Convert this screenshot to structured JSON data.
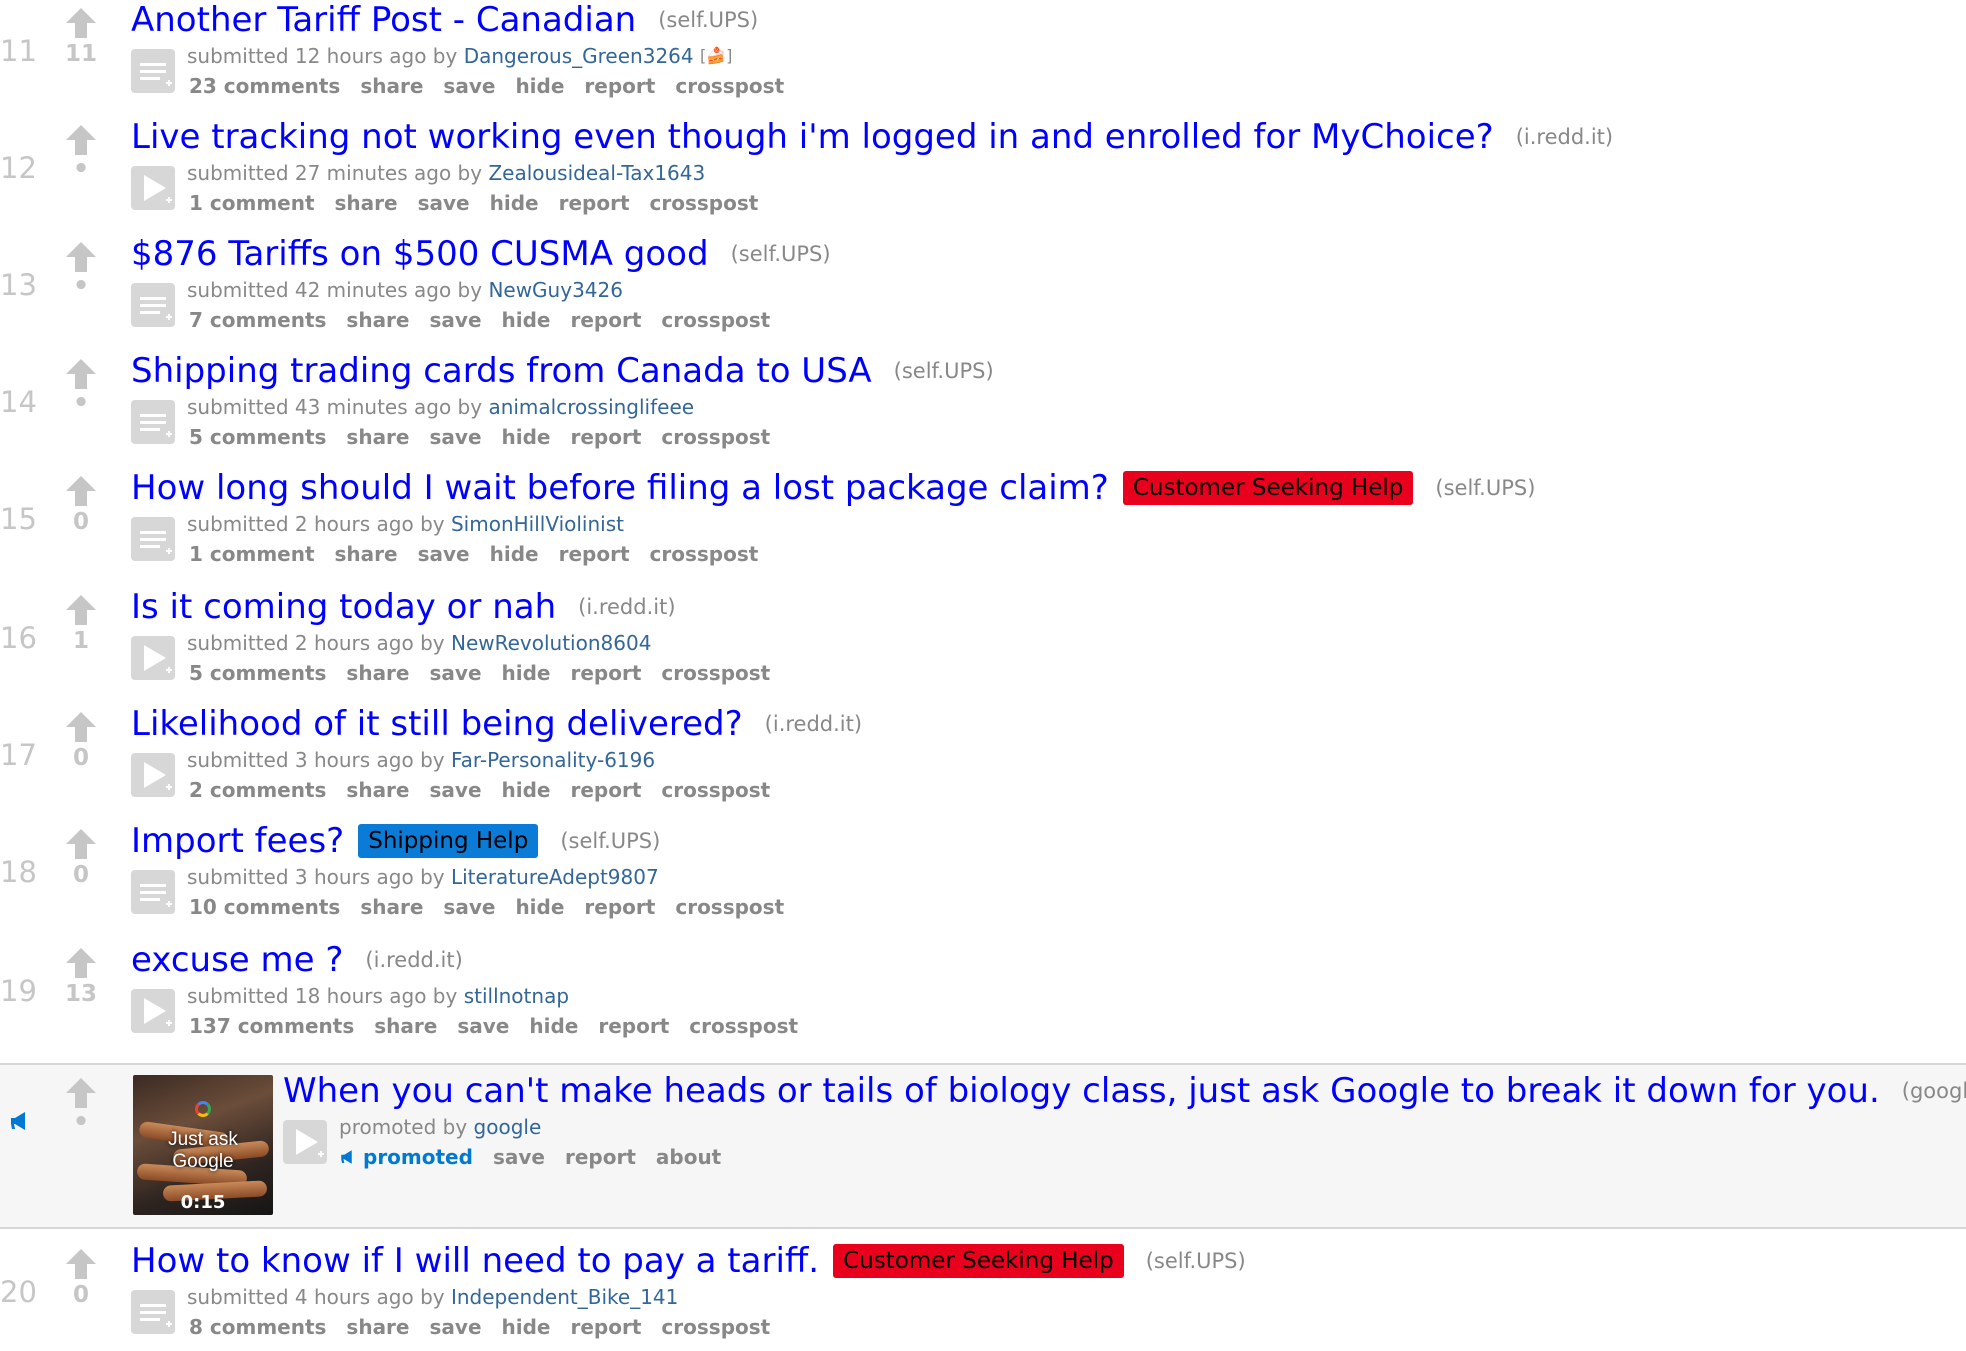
{
  "posts": [
    {
      "rank": "11",
      "score": "11",
      "title": "Another Tariff Post - Canadian",
      "flair": "",
      "domain": "(self.UPS)",
      "thumb": "self",
      "submitted": "submitted 12 hours ago by",
      "author": "Dangerous_Green3264",
      "cake": "[🍰]",
      "comments": "23 comments"
    },
    {
      "rank": "12",
      "score": "•",
      "title": "Live tracking not working even though i'm logged in and enrolled for MyChoice?",
      "flair": "",
      "domain": "(i.redd.it)",
      "thumb": "image",
      "submitted": "submitted 27 minutes ago by",
      "author": "Zealousideal-Tax1643",
      "comments": "1 comment"
    },
    {
      "rank": "13",
      "score": "•",
      "title": "$876 Tariffs on $500 CUSMA good",
      "flair": "",
      "domain": "(self.UPS)",
      "thumb": "self",
      "submitted": "submitted 42 minutes ago by",
      "author": "NewGuy3426",
      "comments": "7 comments"
    },
    {
      "rank": "14",
      "score": "•",
      "title": "Shipping trading cards from Canada to USA",
      "flair": "",
      "domain": "(self.UPS)",
      "thumb": "self",
      "submitted": "submitted 43 minutes ago by",
      "author": "animalcrossinglifeee",
      "comments": "5 comments"
    },
    {
      "rank": "15",
      "score": "0",
      "title": "How long should I wait before filing a lost package claim?",
      "flair": "Customer Seeking Help",
      "flair_color": "#e8001c",
      "domain": "(self.UPS)",
      "thumb": "self",
      "submitted": "submitted 2 hours ago by",
      "author": "SimonHillViolinist",
      "comments": "1 comment"
    },
    {
      "rank": "16",
      "score": "1",
      "title": "Is it coming today or nah",
      "flair": "",
      "domain": "(i.redd.it)",
      "thumb": "image",
      "submitted": "submitted 2 hours ago by",
      "author": "NewRevolution8604",
      "comments": "5 comments"
    },
    {
      "rank": "17",
      "score": "0",
      "title": "Likelihood of it still being delivered?",
      "flair": "",
      "domain": "(i.redd.it)",
      "thumb": "image",
      "submitted": "submitted 3 hours ago by",
      "author": "Far-Personality-6196",
      "comments": "2 comments"
    },
    {
      "rank": "18",
      "score": "0",
      "title": "Import fees?",
      "flair": "Shipping Help",
      "flair_color": "#0a7bd6",
      "domain": "(self.UPS)",
      "thumb": "self",
      "submitted": "submitted 3 hours ago by",
      "author": "LiteratureAdept9807",
      "comments": "10 comments"
    },
    {
      "rank": "19",
      "score": "13",
      "title": "excuse me ?",
      "flair": "",
      "domain": "(i.redd.it)",
      "thumb": "image",
      "submitted": "submitted 18 hours ago by",
      "author": "stillnotnap",
      "comments": "137 comments"
    }
  ],
  "actions": {
    "share": "share",
    "save": "save",
    "hide": "hide",
    "report": "report",
    "crosspost": "crosspost"
  },
  "promoted": {
    "score": "•",
    "title": "When you can't make heads or tails of biology class, just ask Google to break it down for you.",
    "domain": "(google.com)",
    "promoted_by": "promoted by",
    "advertiser": "google",
    "promoted_label": "promoted",
    "save": "save",
    "report": "report",
    "about": "about",
    "thumb_text_line1": "Just ask",
    "thumb_text_line2": "Google",
    "duration": "0:15"
  },
  "last_post": {
    "rank": "20",
    "score": "0",
    "title": "How to know if I will need to pay a tariff.",
    "flair": "Customer Seeking Help",
    "flair_color": "#e8001c",
    "domain": "(self.UPS)",
    "thumb": "self",
    "submitted": "submitted 4 hours ago by",
    "author": "Independent_Bike_141",
    "comments": "8 comments"
  },
  "colors": {
    "title_link": "#0000ff",
    "author_link": "#336699",
    "meta_gray": "#888888",
    "promoted_blue": "#0079d3"
  }
}
